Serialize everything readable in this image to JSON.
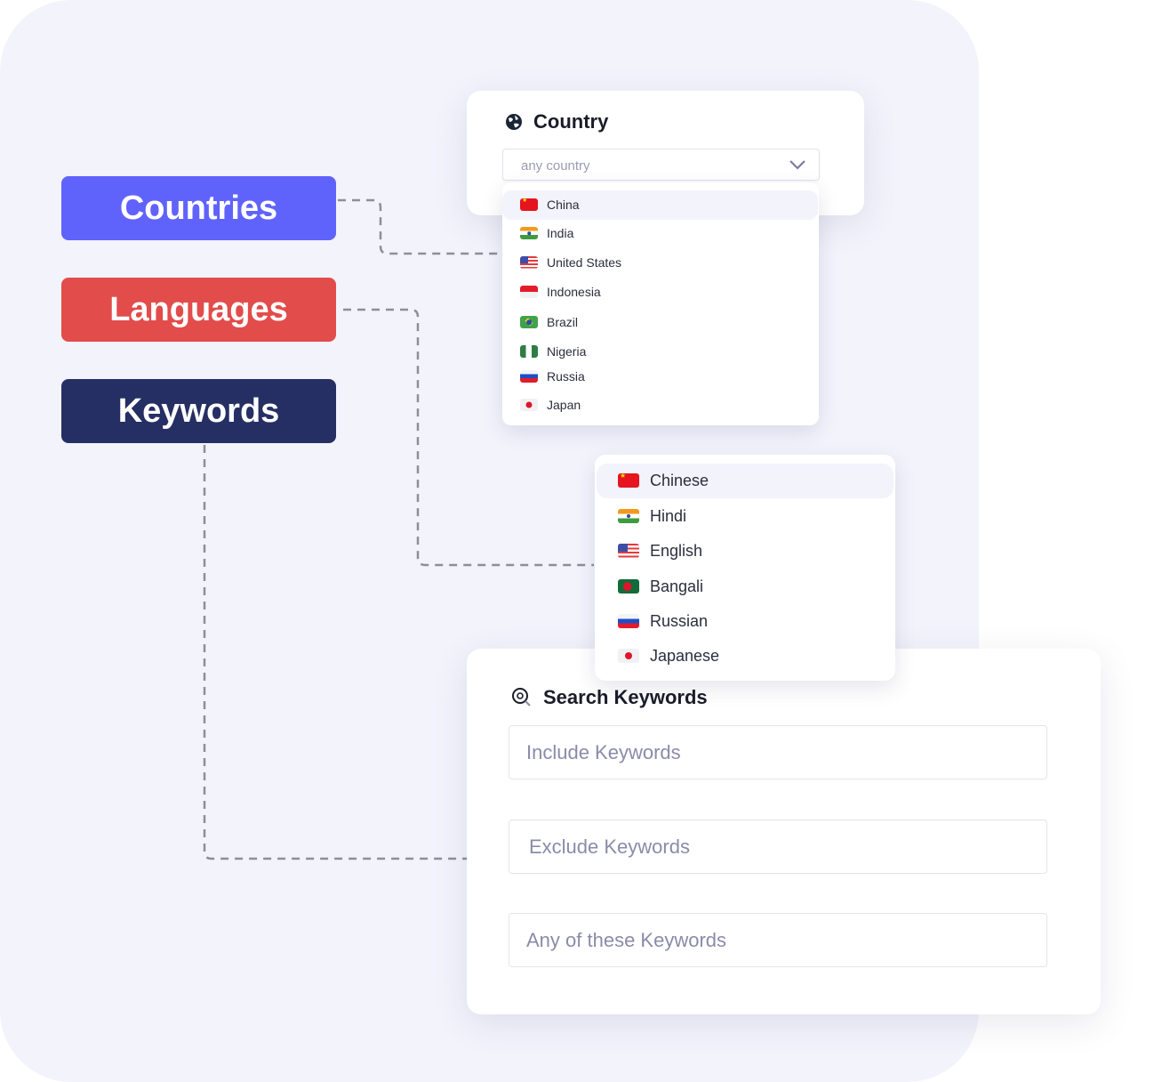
{
  "pills": [
    {
      "label": "Countries",
      "color": "#6063fb"
    },
    {
      "label": "Languages",
      "color": "#e24c4b"
    },
    {
      "label": "Keywords",
      "color": "#262f63"
    }
  ],
  "country": {
    "title": "Country",
    "icon": "globe-icon",
    "placeholder": "any country",
    "options": [
      {
        "label": "China",
        "flag": "cn"
      },
      {
        "label": "India",
        "flag": "in"
      },
      {
        "label": "United States",
        "flag": "us"
      },
      {
        "label": "Indonesia",
        "flag": "id"
      },
      {
        "label": "Brazil",
        "flag": "br"
      },
      {
        "label": "Nigeria",
        "flag": "ng"
      },
      {
        "label": "Russia",
        "flag": "ru"
      },
      {
        "label": "Japan",
        "flag": "jp"
      }
    ]
  },
  "languages": {
    "options": [
      {
        "label": "Chinese",
        "flag": "cn"
      },
      {
        "label": "Hindi",
        "flag": "in"
      },
      {
        "label": "English",
        "flag": "us"
      },
      {
        "label": "Bangali",
        "flag": "bd"
      },
      {
        "label": "Russian",
        "flag": "ru"
      },
      {
        "label": "Japanese",
        "flag": "jp"
      }
    ]
  },
  "keywords": {
    "title": "Search Keywords",
    "icon": "search-icon",
    "include_placeholder": "Include Keywords",
    "exclude_placeholder": "Exclude Keywords",
    "any_placeholder": "Any of these Keywords"
  }
}
